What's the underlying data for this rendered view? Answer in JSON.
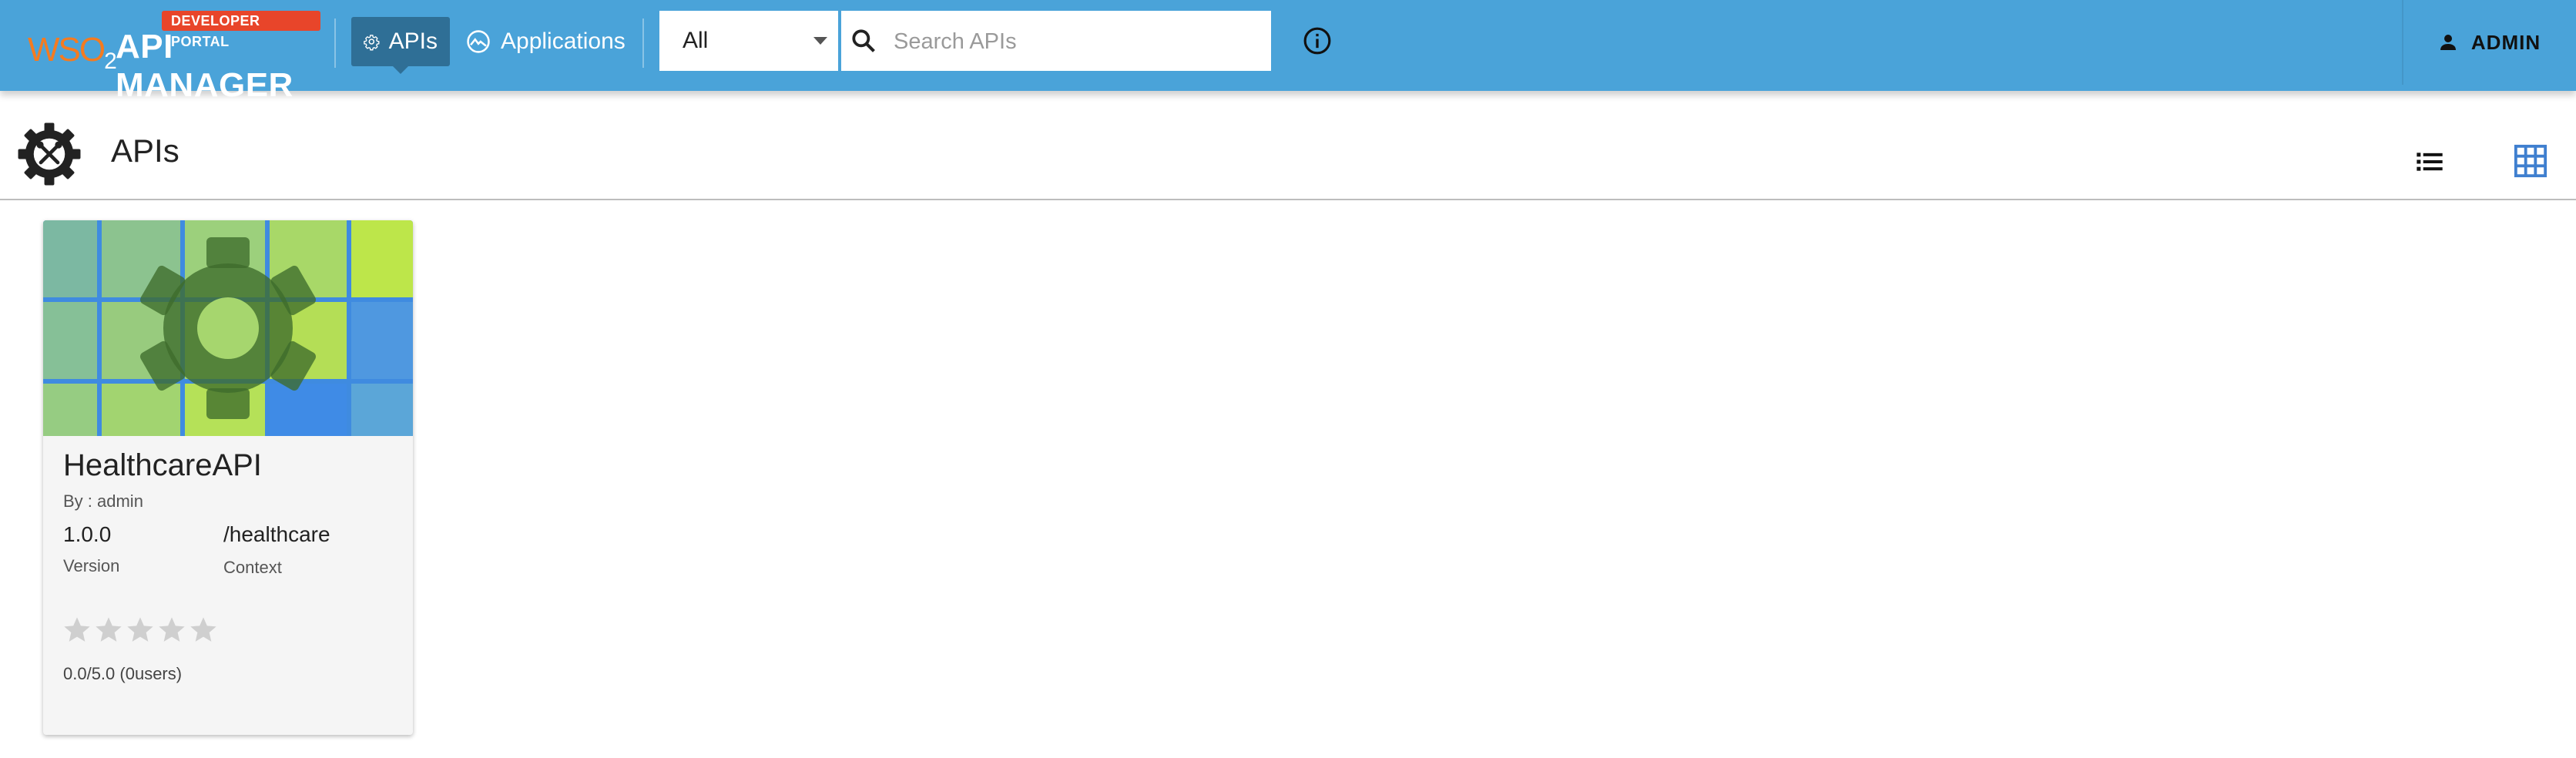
{
  "header": {
    "logo_wso2": "WSO",
    "logo_wso2_sub": "2",
    "logo_product": "API MANAGER",
    "portal_badge": "DEVELOPER PORTAL",
    "nav": [
      {
        "label": "APIs",
        "icon": "gear-icon",
        "active": true
      },
      {
        "label": "Applications",
        "icon": "applications-icon",
        "active": false
      }
    ],
    "filter_select": {
      "value": "All"
    },
    "search": {
      "placeholder": "Search APIs",
      "value": ""
    },
    "info_icon": "info-icon",
    "user": {
      "label": "ADMIN",
      "icon": "person-icon"
    }
  },
  "page": {
    "title": "APIs",
    "title_icon": "api-gear-icon",
    "view_toggles": [
      {
        "name": "list-view",
        "icon": "list-icon",
        "active": false
      },
      {
        "name": "grid-view",
        "icon": "grid-icon",
        "active": true
      }
    ]
  },
  "cards": [
    {
      "name": "HealthcareAPI",
      "by": "By : admin",
      "version": "1.0.0",
      "version_label": "Version",
      "context": "/healthcare",
      "context_label": "Context",
      "rating_stars": 0,
      "rating_max": 5,
      "rating_text": "0.0/5.0 (0users)"
    }
  ],
  "colors": {
    "header_bg": "#4aa3d9",
    "active_nav": "#2f6f96",
    "badge": "#e8452a",
    "grid_toggle_active": "#3f7fcf"
  }
}
